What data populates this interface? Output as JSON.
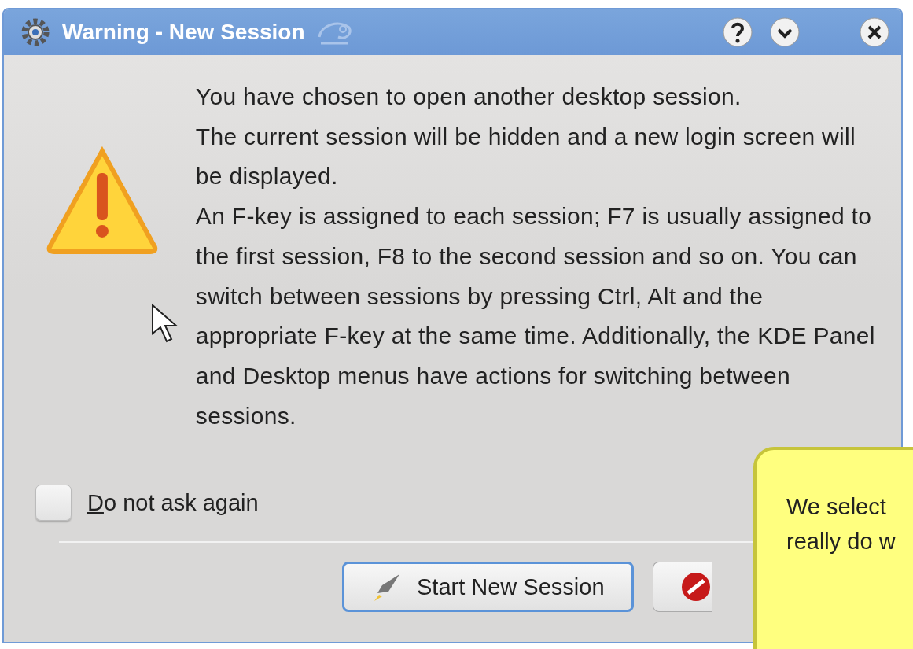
{
  "window": {
    "title": "Warning - New Session"
  },
  "message": [
    "You have chosen to open another desktop session.",
    "The current session will be hidden and a new login screen will be displayed.",
    "An F-key is assigned to each session; F7 is usually assigned to the first session, F8 to the second session and so on. You can switch between sessions by pressing Ctrl, Alt and the appropriate F-key at the same time. Additionally, the KDE Panel and Desktop menus have actions for switching between sessions."
  ],
  "checkbox": {
    "label": "Do not ask again",
    "checked": false
  },
  "buttons": [
    {
      "kind": "start",
      "label": "Start New Session",
      "focused": true
    },
    {
      "kind": "cancel",
      "focused": false
    }
  ],
  "note": {
    "lines": [
      "We select",
      "really do w"
    ]
  }
}
